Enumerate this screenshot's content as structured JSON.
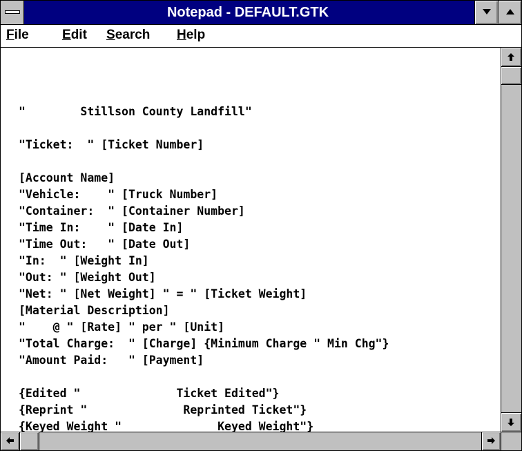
{
  "window": {
    "title": "Notepad - DEFAULT.GTK",
    "title_bar_color": "#000080",
    "chrome_color": "#c0c0c0"
  },
  "menu": {
    "file": {
      "mnemonic": "F",
      "rest": "ile"
    },
    "edit": {
      "mnemonic": "E",
      "rest": "dit"
    },
    "search": {
      "mnemonic": "S",
      "rest": "earch"
    },
    "help": {
      "mnemonic": "H",
      "rest": "elp"
    }
  },
  "document": {
    "lines": [
      "",
      "\"        Stillson County Landfill\"",
      "",
      "\"Ticket:  \" [Ticket Number]",
      "",
      "[Account Name]",
      "\"Vehicle:    \" [Truck Number]",
      "\"Container:  \" [Container Number]",
      "\"Time In:    \" [Date In]",
      "\"Time Out:   \" [Date Out]",
      "\"In:  \" [Weight In]",
      "\"Out: \" [Weight Out]",
      "\"Net: \" [Net Weight] \" = \" [Ticket Weight]",
      "[Material Description]",
      "\"    @ \" [Rate] \" per \" [Unit]",
      "\"Total Charge:  \" [Charge] {Minimum Charge \" Min Chg\"}",
      "\"Amount Paid:   \" [Payment]",
      "",
      "{Edited \"              Ticket Edited\"}",
      "{Reprint \"              Reprinted Ticket\"}",
      "{Keyed Weight \"              Keyed Weight\"}"
    ]
  },
  "icons": {
    "system_menu": "system-menu-icon",
    "minimize": "minimize-arrow-icon",
    "maximize": "maximize-arrow-icon",
    "scroll_up": "arrow-up-icon",
    "scroll_down": "arrow-down-icon",
    "scroll_left": "arrow-left-icon",
    "scroll_right": "arrow-right-icon"
  }
}
